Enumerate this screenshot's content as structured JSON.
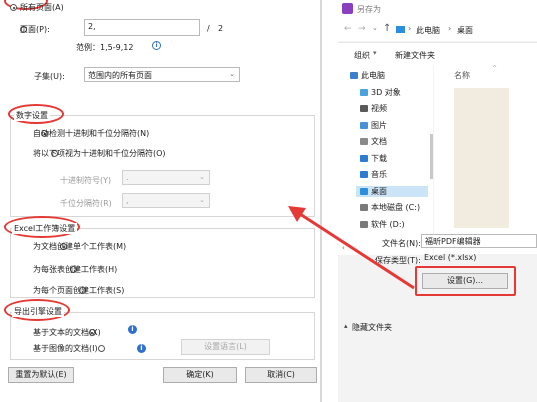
{
  "left_dialog": {
    "page_range": {
      "all_pages_label": "所有页面(A)",
      "pages_label": "页面(P):",
      "pages_value": "2,",
      "pages_separator": "/",
      "pages_total": "2",
      "example_label": "范例：1,5-9,12",
      "subset_label": "子集(U):",
      "subset_value": "范围内的所有页面"
    },
    "digit_settings": {
      "title": "数字设置",
      "auto_label": "自动检测十进制和千位分隔符(N)",
      "manual_label": "将以下项视为十进制和千位分隔符(O)",
      "decimal_label": "十进制符号(Y)",
      "decimal_value": ".",
      "thousands_label": "千位分隔符(R)",
      "thousands_value": ","
    },
    "excel_settings": {
      "title": "Excel工作簿设置",
      "opt1": "为文档创建单个工作表(M)",
      "opt2": "为每张表创建工作表(H)",
      "opt3": "为每个页面创建工作表(S)"
    },
    "export_engine": {
      "title": "导出引擎设置",
      "opt1": "基于文本的文档(X)",
      "opt2": "基于图像的文档(I)",
      "ocr_button": "设置语言(L)"
    },
    "buttons": {
      "reset": "重置为默认(E)",
      "ok": "确定(K)",
      "cancel": "取消(C)"
    },
    "info_icon_glyph": "i"
  },
  "right_dialog": {
    "title": "另存为",
    "breadcrumb": [
      "此电脑",
      "桌面"
    ],
    "toolbar": {
      "organize": "组织",
      "new_folder": "新建文件夹"
    },
    "nav_items": [
      {
        "label": "此电脑",
        "icon": "computer-icon",
        "color": "#3c7fd1"
      },
      {
        "label": "3D 对象",
        "icon": "3d-objects-icon",
        "color": "#4aa3df"
      },
      {
        "label": "视频",
        "icon": "video-icon",
        "color": "#5a5a5a"
      },
      {
        "label": "图片",
        "icon": "pictures-icon",
        "color": "#4a90d9"
      },
      {
        "label": "文档",
        "icon": "documents-icon",
        "color": "#8a8a8a"
      },
      {
        "label": "下载",
        "icon": "download-icon",
        "color": "#2b7cd3"
      },
      {
        "label": "音乐",
        "icon": "music-icon",
        "color": "#2b7cd3"
      },
      {
        "label": "桌面",
        "icon": "desktop-icon",
        "color": "#2b8fe0"
      },
      {
        "label": "本地磁盘 (C:)",
        "icon": "disk-icon",
        "color": "#7a7a7a"
      },
      {
        "label": "软件 (D:)",
        "icon": "disk-icon",
        "color": "#7a7a7a"
      }
    ],
    "column_header": "名称",
    "filename_label": "文件名(N):",
    "filename_value": "福昕PDF编辑器",
    "filetype_label": "保存类型(T):",
    "filetype_value": "Excel (*.xlsx)",
    "settings_button": "设置(G)...",
    "hide_folders": "隐藏文件夹",
    "accent_color": "#e53935"
  }
}
